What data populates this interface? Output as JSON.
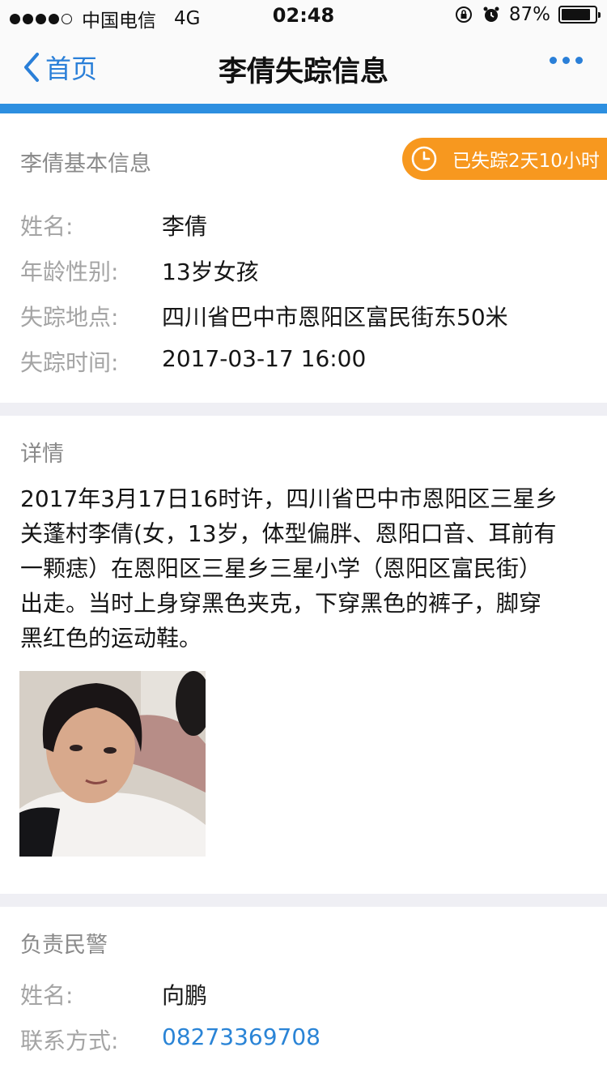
{
  "status_bar": {
    "carrier": "中国电信",
    "network": "4G",
    "time": "02:48",
    "battery": "87%",
    "battery_level": 0.87
  },
  "nav": {
    "back_label": "首页",
    "title": "李倩失踪信息"
  },
  "basic_info": {
    "section_title": "李倩基本信息",
    "missing_duration": "已失踪2天10小时",
    "rows": [
      {
        "label": "姓名:",
        "value": "李倩"
      },
      {
        "label": "年龄性别:",
        "value": "13岁女孩"
      },
      {
        "label": "失踪地点:",
        "value": "四川省巴中市恩阳区富民街东50米"
      },
      {
        "label": "失踪时间:",
        "value": "2017-03-17 16:00"
      }
    ]
  },
  "details": {
    "section_title": "详情",
    "lines": [
      "2017年3月17日16时许，四川省巴中市恩阳区三星乡",
      "关蓬村李倩(女，13岁，体型偏胖、恩阳口音、耳前有",
      "一颗痣）在恩阳区三星乡三星小学（恩阳区富民街）",
      "出走。当时上身穿黑色夹克，下穿黑色的裤子，脚穿",
      "黑红色的运动鞋。"
    ]
  },
  "police": {
    "section_title": "负责民警",
    "name_label": "姓名:",
    "name_value": "向鹏",
    "contact_label": "联系方式:",
    "contact_value": "08273369708"
  },
  "colors": {
    "accent_blue": "#2d8fe0",
    "badge_orange": "#f7981f",
    "link_blue": "#2a84d6"
  }
}
